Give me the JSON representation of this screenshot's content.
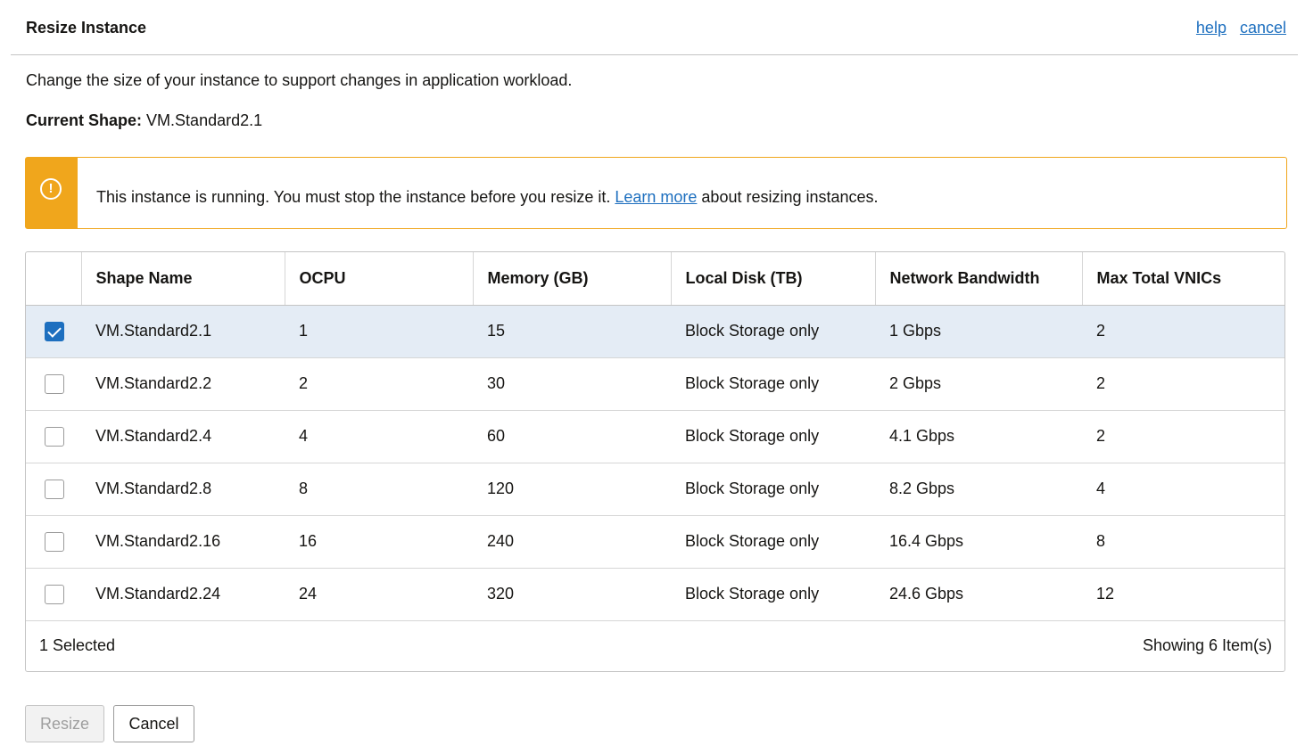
{
  "header": {
    "title": "Resize Instance",
    "help_link": "help",
    "cancel_link": "cancel"
  },
  "description": "Change the size of your instance to support changes in application workload.",
  "current_shape": {
    "label": "Current Shape:",
    "value": "VM.Standard2.1"
  },
  "alert": {
    "icon": "warning-icon",
    "text_before": "This instance is running. You must stop the instance before you resize it.",
    "link_text": "Learn more",
    "text_after": "about resizing instances.",
    "color": "#f0a61c"
  },
  "table": {
    "columns": [
      "",
      "Shape Name",
      "OCPU",
      "Memory (GB)",
      "Local Disk (TB)",
      "Network Bandwidth",
      "Max Total VNICs"
    ],
    "rows": [
      {
        "checked": true,
        "cells": [
          "VM.Standard2.1",
          "1",
          "15",
          "Block Storage only",
          "1 Gbps",
          "2"
        ]
      },
      {
        "checked": false,
        "cells": [
          "VM.Standard2.2",
          "2",
          "30",
          "Block Storage only",
          "2 Gbps",
          "2"
        ]
      },
      {
        "checked": false,
        "cells": [
          "VM.Standard2.4",
          "4",
          "60",
          "Block Storage only",
          "4.1 Gbps",
          "2"
        ]
      },
      {
        "checked": false,
        "cells": [
          "VM.Standard2.8",
          "8",
          "120",
          "Block Storage only",
          "8.2 Gbps",
          "4"
        ]
      },
      {
        "checked": false,
        "cells": [
          "VM.Standard2.16",
          "16",
          "240",
          "Block Storage only",
          "16.4 Gbps",
          "8"
        ]
      },
      {
        "checked": false,
        "cells": [
          "VM.Standard2.24",
          "24",
          "320",
          "Block Storage only",
          "24.6 Gbps",
          "12"
        ]
      }
    ],
    "footer_selected": "1 Selected",
    "footer_count": "Showing 6 Item(s)",
    "selected_row_color": "#e4ecf5",
    "accent_color": "#1d6fbf"
  },
  "buttons": {
    "resize": "Resize",
    "cancel": "Cancel"
  }
}
